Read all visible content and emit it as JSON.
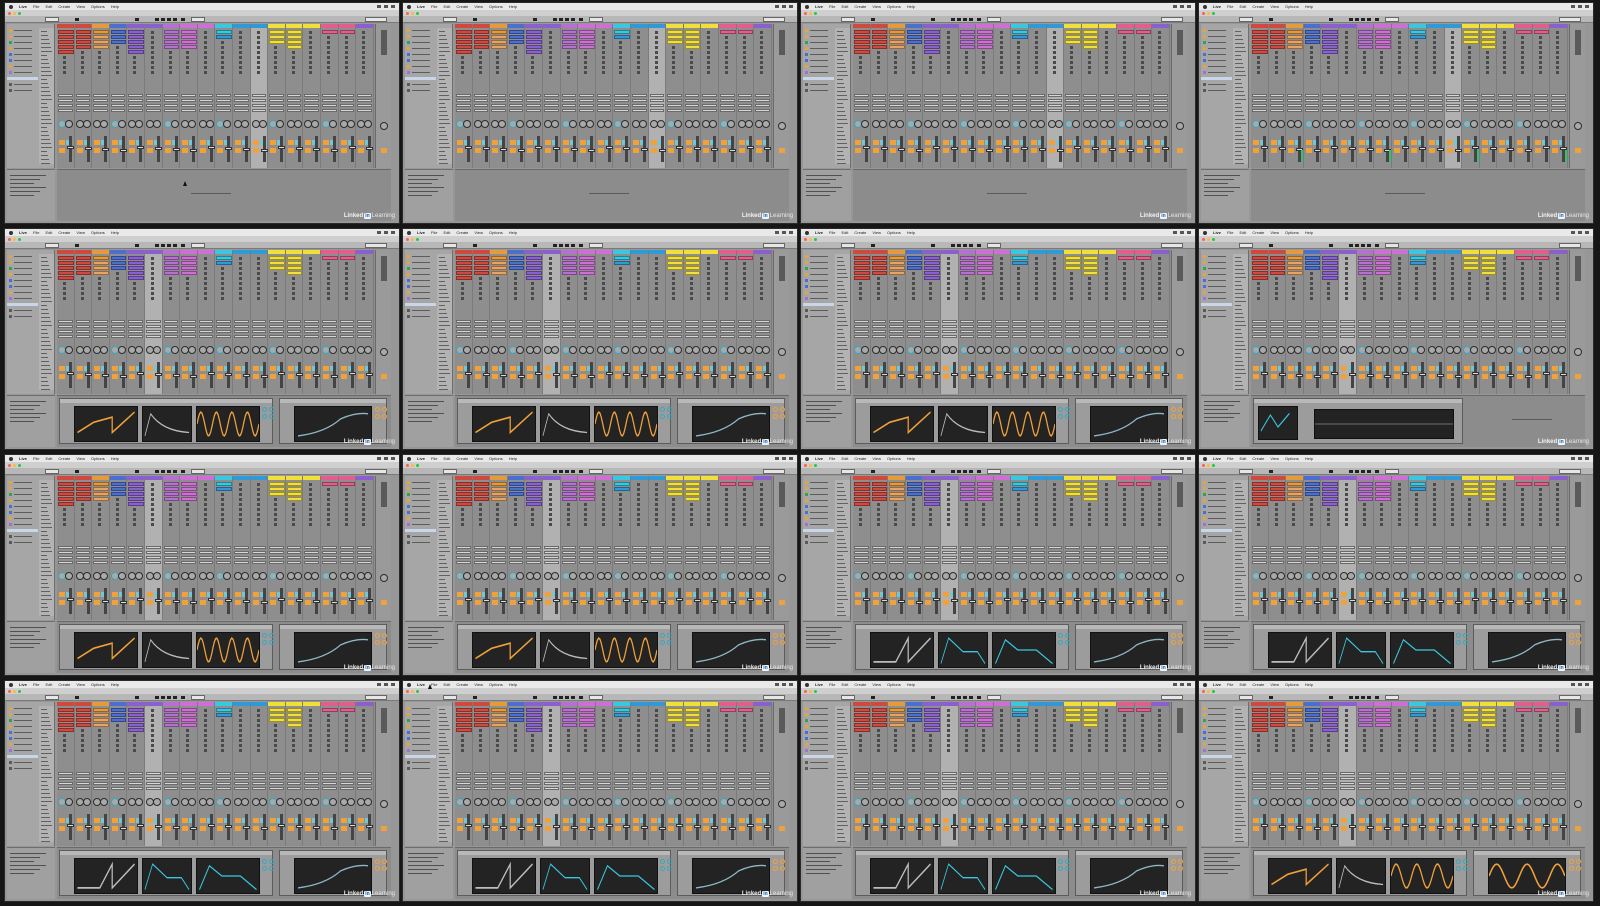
{
  "menu": {
    "app_name": "Live",
    "items": [
      "File",
      "Edit",
      "Create",
      "View",
      "Options",
      "Help"
    ]
  },
  "watermark": {
    "brand": "Linked",
    "badge": "in",
    "suffix": "Learning"
  },
  "colors": {
    "red": "#d0493e",
    "orange": "#e59a3c",
    "peach": "#e7a460",
    "blue": "#4a6ed1",
    "violet": "#8a5fd0",
    "purple": "#b86fd2",
    "magenta": "#cf6fd6",
    "cyan": "#38c9e0",
    "sky": "#2f9ad8",
    "yellow": "#f1df3a",
    "lime": "#c9d93b",
    "pink": "#e35d8e",
    "teal": "#3aa6bd",
    "knob_orange": "#f0a13a",
    "display_bg": "#232323"
  },
  "frames": [
    {
      "detail": "empty",
      "selected_track": 11,
      "pointer": true
    },
    {
      "detail": "empty",
      "selected_track": 11,
      "pointer": false
    },
    {
      "detail": "empty",
      "selected_track": 11,
      "pointer": false
    },
    {
      "detail": "empty",
      "selected_track": 11,
      "pointer": false,
      "meters": true
    },
    {
      "detail": "synth_orange",
      "selected_track": 5,
      "pointer": false
    },
    {
      "detail": "synth_orange",
      "selected_track": 5,
      "pointer": false
    },
    {
      "detail": "synth_orange",
      "selected_track": 5,
      "pointer": false
    },
    {
      "detail": "plugin",
      "selected_track": 5,
      "pointer": false
    },
    {
      "detail": "synth_orange",
      "selected_track": 5,
      "pointer": false
    },
    {
      "detail": "synth_orange",
      "selected_track": 5,
      "pointer": false
    },
    {
      "detail": "synth_gray",
      "selected_track": 5,
      "pointer": false
    },
    {
      "detail": "synth_gray",
      "selected_track": 5,
      "pointer": false
    },
    {
      "detail": "synth_gray",
      "selected_track": 5,
      "pointer": false
    },
    {
      "detail": "synth_gray",
      "selected_track": 5,
      "pointer": true
    },
    {
      "detail": "synth_gray",
      "selected_track": 5,
      "pointer": false
    },
    {
      "detail": "synth_mixed",
      "selected_track": 5,
      "pointer": false
    }
  ]
}
